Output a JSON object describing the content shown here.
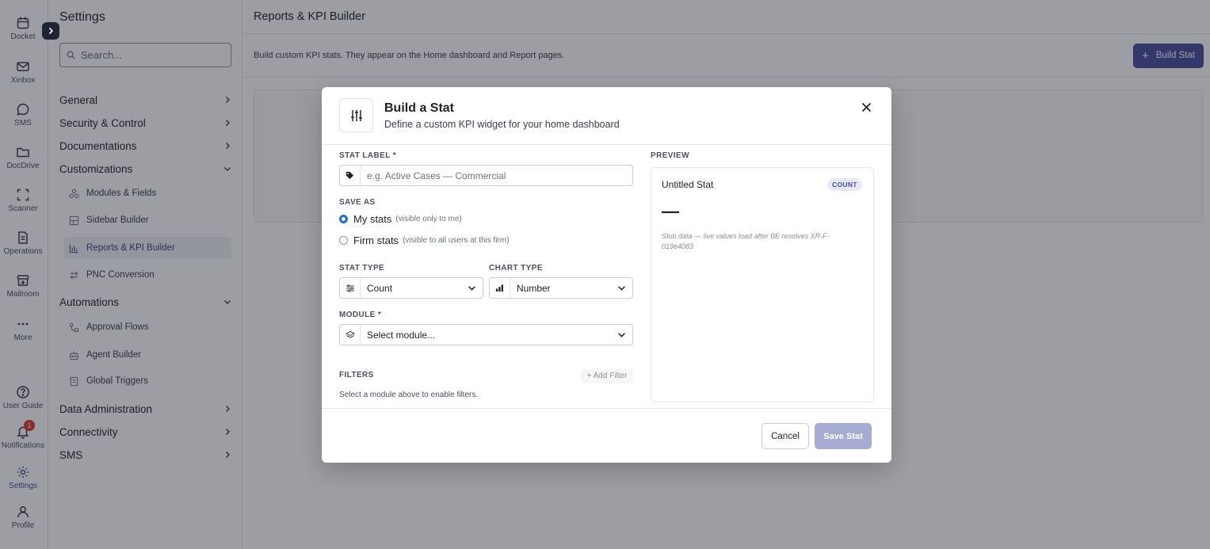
{
  "rail": {
    "items": [
      {
        "label": "Docket",
        "icon": "calendar-icon"
      },
      {
        "label": "Xinbox",
        "icon": "mail-icon"
      },
      {
        "label": "SMS",
        "icon": "chat-bubble-icon"
      },
      {
        "label": "DocDrive",
        "icon": "folder-icon"
      },
      {
        "label": "Scanner",
        "icon": "scan-icon"
      },
      {
        "label": "Operations",
        "icon": "document-icon"
      },
      {
        "label": "Mailroom",
        "icon": "mailbox-icon"
      },
      {
        "label": "More",
        "icon": "more-icon"
      },
      {
        "label": "User Guide",
        "icon": "help-icon"
      },
      {
        "label": "Notifications",
        "icon": "bell-icon",
        "badge": "1"
      },
      {
        "label": "Settings",
        "icon": "gear-icon"
      },
      {
        "label": "Profile",
        "icon": "user-icon"
      }
    ]
  },
  "sidebar": {
    "title": "Settings",
    "search_placeholder": "Search...",
    "groups": [
      {
        "label": "General",
        "expanded": false
      },
      {
        "label": "Security & Control",
        "expanded": false
      },
      {
        "label": "Documentations",
        "expanded": false
      },
      {
        "label": "Customizations",
        "expanded": true
      },
      {
        "label": "Automations",
        "expanded": true
      },
      {
        "label": "Data Administration",
        "expanded": false
      },
      {
        "label": "Connectivity",
        "expanded": false
      },
      {
        "label": "SMS",
        "expanded": false
      }
    ],
    "customizations_items": [
      "Modules & Fields",
      "Sidebar Builder",
      "Reports & KPI Builder",
      "PNC Conversion"
    ],
    "automations_items": [
      "Approval Flows",
      "Agent Builder",
      "Global Triggers"
    ],
    "active_item": "Reports & KPI Builder"
  },
  "main": {
    "title": "Reports & KPI Builder",
    "description": "Build custom KPI stats. They appear on the Home dashboard and Report pages.",
    "build_button": "Build Stat"
  },
  "modal": {
    "title": "Build a Stat",
    "subtitle": "Define a custom KPI widget for your home dashboard",
    "stat_label": {
      "label": "STAT LABEL *",
      "placeholder": "e.g. Active Cases — Commercial"
    },
    "save_as": {
      "label": "SAVE AS",
      "options": [
        {
          "label": "My stats",
          "note": "(visible only to me)",
          "selected": true
        },
        {
          "label": "Firm stats",
          "note": "(visible to all users at this firm)",
          "selected": false
        }
      ]
    },
    "stat_type": {
      "label": "STAT TYPE",
      "value": "Count"
    },
    "chart_type": {
      "label": "CHART TYPE",
      "value": "Number"
    },
    "module": {
      "label": "MODULE *",
      "value": "Select module..."
    },
    "filters": {
      "label": "FILTERS",
      "add_label": "+ Add Filter",
      "note": "Select a module above to enable filters."
    },
    "preview": {
      "label": "PREVIEW",
      "title": "Untitled Stat",
      "badge": "COUNT",
      "value": "—",
      "note": "Stub data — live values load after BE resolves XR-F-019e4083"
    },
    "cancel": "Cancel",
    "save": "Save Stat"
  },
  "colors": {
    "accent": "#4b4f9e",
    "accent_disabled": "#a7aad3",
    "radio": "#1a6ed8",
    "badge_red": "#d93b30"
  }
}
